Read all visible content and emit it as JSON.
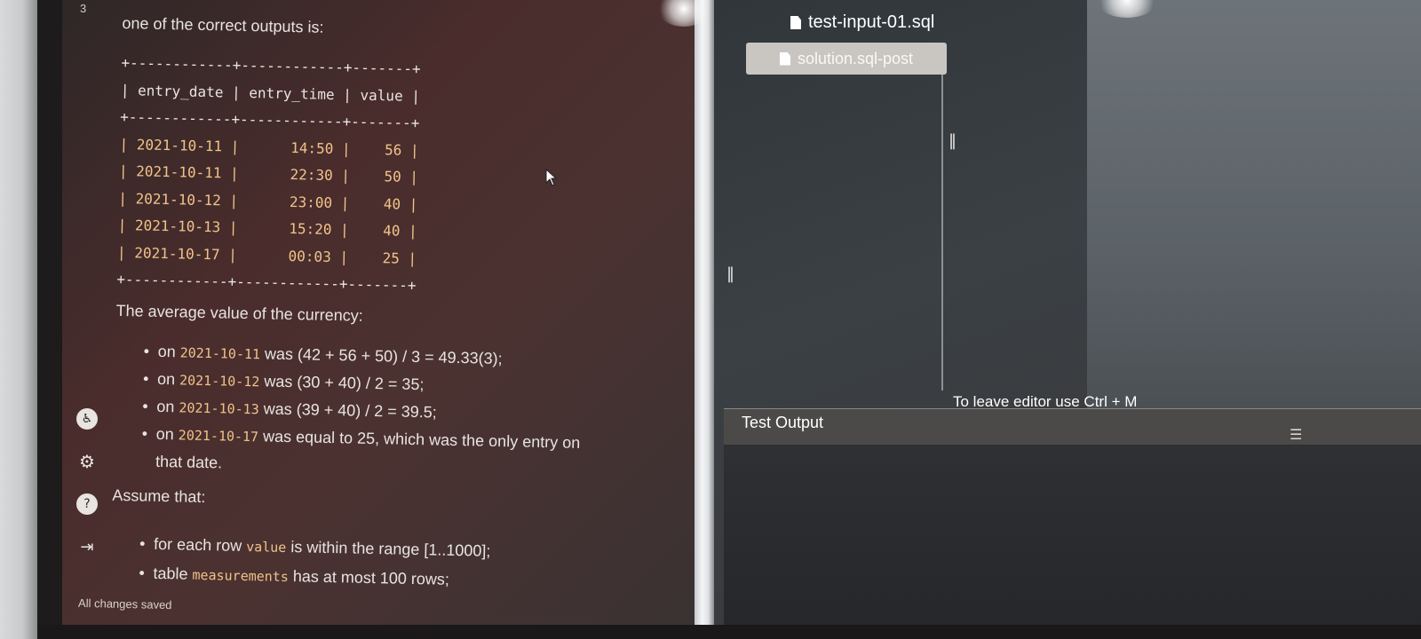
{
  "line_number": "3",
  "description": {
    "intro": "one of the correct outputs is:",
    "ascii_table": {
      "border": "+------------+------------+-------+",
      "header": "| entry_date | entry_time | value |",
      "rows": [
        "| 2021-10-11 |      14:50 |    56 |",
        "| 2021-10-11 |      22:30 |    50 |",
        "| 2021-10-12 |      23:00 |    40 |",
        "| 2021-10-13 |      15:20 |    40 |",
        "| 2021-10-17 |      00:03 |    25 |"
      ]
    },
    "average_title": "The average value of the currency:",
    "bullets": [
      {
        "prefix": "on ",
        "code": "2021-10-11",
        "text": " was (42 + 56 + 50) / 3 = 49.33(3);"
      },
      {
        "prefix": "on ",
        "code": "2021-10-12",
        "text": " was (30 + 40) / 2 = 35;"
      },
      {
        "prefix": "on ",
        "code": "2021-10-13",
        "text": " was (39 + 40) / 2 = 39.5;"
      },
      {
        "prefix": "on ",
        "code": "2021-10-17",
        "text": " was equal to 25, which was the only entry on that date."
      }
    ],
    "assume_title": "Assume that:",
    "assume_items": [
      {
        "prefix": "for each row ",
        "code": "value",
        "text": " is within the range [1..1000];"
      },
      {
        "prefix": "table ",
        "code": "measurements",
        "text": " has at most 100 rows;"
      }
    ]
  },
  "status_text": "All changes saved",
  "editor": {
    "tab_input": "test-input-01.sql",
    "tab_solution": "solution.sql-post",
    "hint": "To leave editor use Ctrl + M",
    "test_output_label": "Test Output"
  },
  "sidebar_icons": [
    "accessibility-icon",
    "gear-icon",
    "help-icon",
    "logout-icon"
  ]
}
